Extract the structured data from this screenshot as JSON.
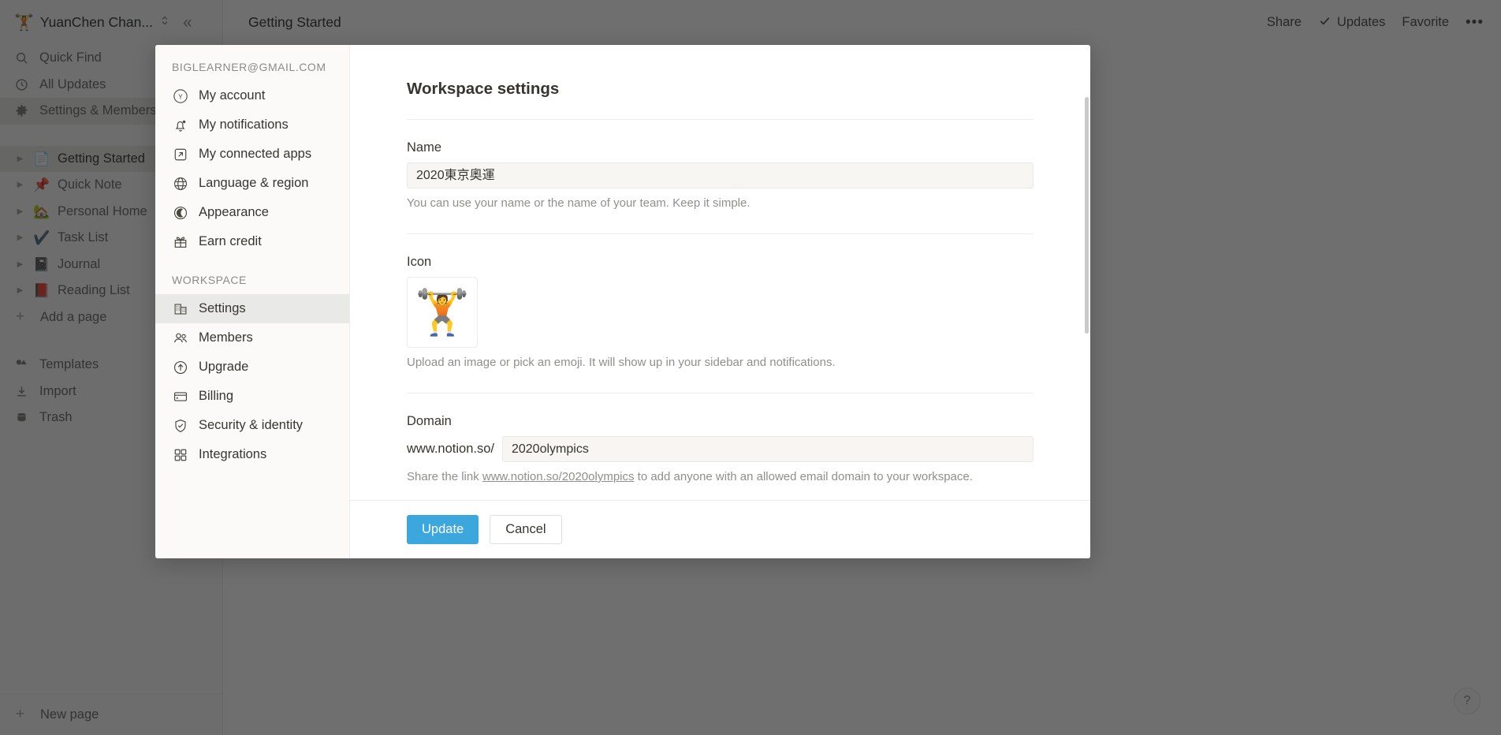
{
  "sidebar": {
    "workspace_emoji": "🏋️",
    "workspace_name": "YuanChen Chan...",
    "nav": [
      {
        "label": "Quick Find",
        "icon": "search-icon"
      },
      {
        "label": "All Updates",
        "icon": "clock-icon"
      },
      {
        "label": "Settings & Members",
        "icon": "gear-icon"
      }
    ],
    "pages": [
      {
        "label": "Getting Started",
        "emoji": "📄"
      },
      {
        "label": "Quick Note",
        "emoji": "📌"
      },
      {
        "label": "Personal Home",
        "emoji": "🏡"
      },
      {
        "label": "Task List",
        "emoji": "✔️"
      },
      {
        "label": "Journal",
        "emoji": "📓"
      },
      {
        "label": "Reading List",
        "emoji": "📕"
      }
    ],
    "add_page_label": "Add a page",
    "tools": [
      {
        "label": "Templates",
        "icon": "templates-icon"
      },
      {
        "label": "Import",
        "icon": "import-icon"
      },
      {
        "label": "Trash",
        "icon": "trash-icon"
      }
    ],
    "new_page_label": "New page"
  },
  "topbar": {
    "page_title": "Getting Started",
    "share_label": "Share",
    "updates_label": "Updates",
    "favorite_label": "Favorite",
    "more_label": "•••"
  },
  "help": {
    "label": "?"
  },
  "modal": {
    "account_section_title": "BIGLEARNER@GMAIL.COM",
    "account_items": [
      {
        "label": "My account",
        "icon": "avatar-y-icon"
      },
      {
        "label": "My notifications",
        "icon": "bell-icon"
      },
      {
        "label": "My connected apps",
        "icon": "external-link-icon"
      },
      {
        "label": "Language & region",
        "icon": "globe-icon"
      },
      {
        "label": "Appearance",
        "icon": "moon-icon"
      },
      {
        "label": "Earn credit",
        "icon": "gift-icon"
      }
    ],
    "workspace_section_title": "WORKSPACE",
    "workspace_items": [
      {
        "label": "Settings",
        "icon": "building-icon",
        "active": true
      },
      {
        "label": "Members",
        "icon": "people-icon",
        "active": false
      },
      {
        "label": "Upgrade",
        "icon": "arrow-up-circle-icon",
        "active": false
      },
      {
        "label": "Billing",
        "icon": "credit-card-icon",
        "active": false
      },
      {
        "label": "Security & identity",
        "icon": "shield-check-icon",
        "active": false
      },
      {
        "label": "Integrations",
        "icon": "grid-icon",
        "active": false
      }
    ],
    "title": "Workspace settings",
    "name_label": "Name",
    "name_value": "2020東京奧運",
    "name_hint": "You can use your name or the name of your team. Keep it simple.",
    "icon_label": "Icon",
    "icon_emoji": "🏋️",
    "icon_hint": "Upload an image or pick an emoji. It will show up in your sidebar and notifications.",
    "domain_label": "Domain",
    "domain_prefix": "www.notion.so/",
    "domain_value": "2020olympics",
    "domain_hint_before": "Share the link ",
    "domain_hint_link": "www.notion.so/2020olympics",
    "domain_hint_after": " to add anyone with an allowed email domain to your workspace.",
    "update_label": "Update",
    "cancel_label": "Cancel"
  },
  "colors": {
    "accent": "#3ba7dd",
    "sidebar_bg": "#fbfaf9",
    "active_row": "#e9e9e7"
  }
}
